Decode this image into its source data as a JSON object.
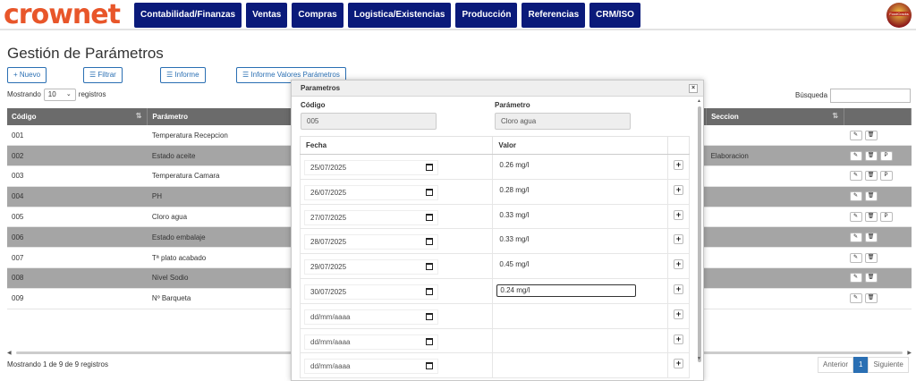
{
  "brand": {
    "logo": "crownet",
    "badge_text": "FoodCracks"
  },
  "nav": [
    "Contabilidad/Finanzas",
    "Ventas",
    "Compras",
    "Logistica/Existencias",
    "Producción",
    "Referencias",
    "CRM/ISO"
  ],
  "page": {
    "title": "Gestión de Parámetros"
  },
  "toolbar": {
    "nuevo": "+ Nuevo",
    "filtrar": "☰ Filtrar",
    "informe": "☰ Informe",
    "informe_valores": "☰ Informe Valores Parámetros"
  },
  "list": {
    "show_prefix": "Mostrando",
    "page_size": "10",
    "show_suffix": "registros",
    "search_label": "Búsqueda",
    "search_value": ""
  },
  "table": {
    "columns": [
      "Código",
      "Parámetro",
      "Seccion"
    ],
    "rows": [
      {
        "codigo": "001",
        "parametro": "Temperatura Recepcion",
        "seccion": "",
        "extra": false
      },
      {
        "codigo": "002",
        "parametro": "Estado aceite",
        "seccion": "Elaboracion",
        "extra": true
      },
      {
        "codigo": "003",
        "parametro": "Temperatura Camara",
        "seccion": "",
        "extra": true
      },
      {
        "codigo": "004",
        "parametro": "PH",
        "seccion": "",
        "extra": false
      },
      {
        "codigo": "005",
        "parametro": "Cloro agua",
        "seccion": "",
        "extra": true
      },
      {
        "codigo": "006",
        "parametro": "Estado embalaje",
        "seccion": "",
        "extra": false
      },
      {
        "codigo": "007",
        "parametro": "Tª plato acabado",
        "seccion": "",
        "extra": false
      },
      {
        "codigo": "008",
        "parametro": "Nivel Sodio",
        "seccion": "",
        "extra": false
      },
      {
        "codigo": "009",
        "parametro": "Nº Barqueta",
        "seccion": "",
        "extra": false
      }
    ]
  },
  "footer": {
    "info": "Mostrando 1 de 9 de 9 registros",
    "prev": "Anterior",
    "page": "1",
    "next": "Siguiente"
  },
  "modal": {
    "title": "Parametros",
    "close": "×",
    "codigo_label": "Código",
    "codigo_value": "005",
    "parametro_label": "Parámetro",
    "parametro_value": "Cloro agua",
    "col_fecha": "Fecha",
    "col_valor": "Valor",
    "values": [
      {
        "fecha": "25/07/2025",
        "valor": "0.26 mg/l"
      },
      {
        "fecha": "26/07/2025",
        "valor": "0.28 mg/l"
      },
      {
        "fecha": "27/07/2025",
        "valor": "0.33 mg/l"
      },
      {
        "fecha": "28/07/2025",
        "valor": "0.33 mg/l"
      },
      {
        "fecha": "29/07/2025",
        "valor": "0.45 mg/l"
      },
      {
        "fecha": "30/07/2025",
        "valor": "0.24 mg/l"
      },
      {
        "fecha": "dd/mm/aaaa",
        "valor": ""
      },
      {
        "fecha": "dd/mm/aaaa",
        "valor": ""
      },
      {
        "fecha": "dd/mm/aaaa",
        "valor": ""
      }
    ]
  },
  "colors": {
    "nav": "#0a1a7a",
    "brand": "#e8562a",
    "accent": "#2a6fb3",
    "header": "#6b6b6b",
    "alt_row": "#a5a5a5"
  }
}
